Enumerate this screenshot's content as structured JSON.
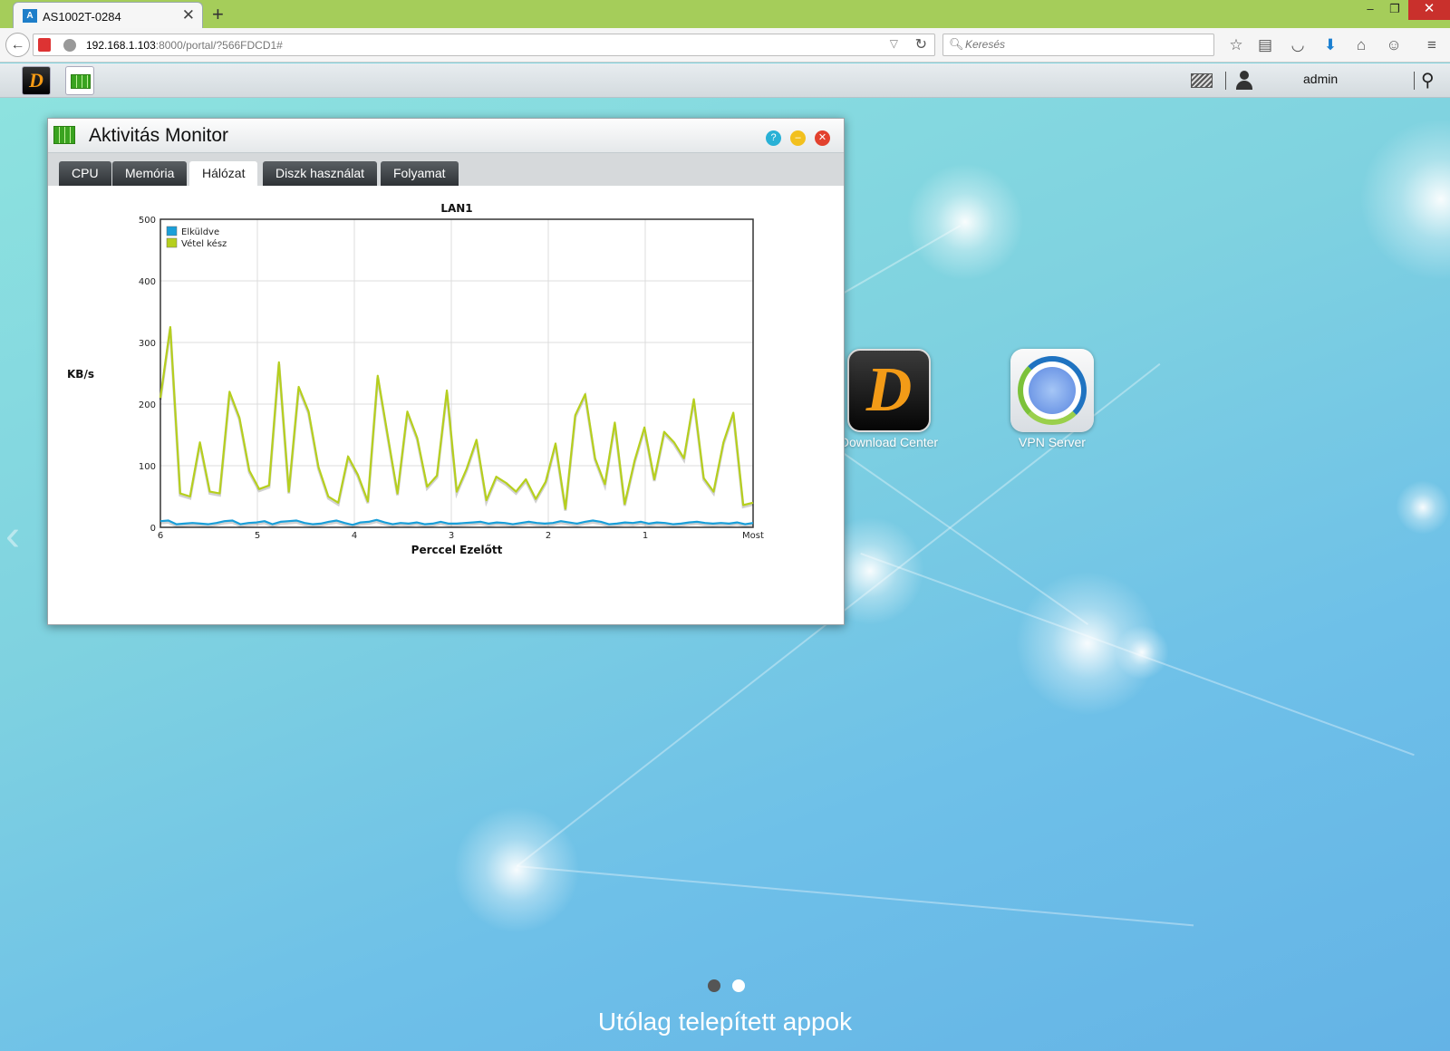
{
  "browser": {
    "tab_title": "AS1002T-0284",
    "tab_favicon": "A",
    "url_host": "192.168.1.103",
    "url_rest": ":8000/portal/?566FDCD1#",
    "search_placeholder": "Keresés"
  },
  "topbar": {
    "user": "admin"
  },
  "window": {
    "title": "Aktivitás Monitor",
    "tabs": [
      {
        "label": "CPU"
      },
      {
        "label": "Memória"
      },
      {
        "label": "Hálózat"
      },
      {
        "label": "Diszk használat"
      },
      {
        "label": "Folyamat"
      }
    ],
    "active_tab": "Hálózat"
  },
  "chart_data": {
    "type": "line",
    "title": "LAN1",
    "xlabel": "Perccel Ezelőtt",
    "ylabel": "KB/s",
    "ylim": [
      0,
      500
    ],
    "yticks": [
      0,
      100,
      200,
      300,
      400,
      500
    ],
    "xticks": [
      "6",
      "5",
      "4",
      "3",
      "2",
      "1",
      "Most"
    ],
    "grid": true,
    "legend_position": "top-left",
    "series": [
      {
        "name": "Elküldve",
        "color": "#1a9fd9",
        "values": [
          10,
          11,
          5,
          6,
          7,
          6,
          5,
          7,
          10,
          11,
          5,
          7,
          8,
          10,
          5,
          9,
          10,
          11,
          7,
          5,
          6,
          9,
          11,
          7,
          4,
          8,
          9,
          12,
          8,
          5,
          7,
          6,
          8,
          5,
          6,
          9,
          6,
          6,
          7,
          8,
          9,
          6,
          8,
          7,
          5,
          7,
          9,
          7,
          6,
          7,
          10,
          8,
          6,
          9,
          11,
          9,
          5,
          6,
          8,
          7,
          9,
          6,
          8,
          7,
          5,
          6,
          8,
          9,
          7,
          6,
          7,
          6,
          8,
          5,
          7
        ]
      },
      {
        "name": "Vétel kész",
        "color": "#b6cf1e",
        "values": [
          210,
          325,
          55,
          50,
          138,
          58,
          55,
          220,
          178,
          92,
          62,
          68,
          268,
          58,
          228,
          188,
          98,
          50,
          40,
          115,
          85,
          42,
          246,
          150,
          55,
          188,
          145,
          66,
          84,
          222,
          58,
          95,
          142,
          44,
          82,
          72,
          58,
          78,
          46,
          74,
          136,
          30,
          182,
          216,
          112,
          70,
          170,
          38,
          108,
          162,
          78,
          155,
          138,
          112,
          208,
          80,
          58,
          138,
          186,
          36,
          40
        ]
      }
    ]
  },
  "desktop": {
    "apps": [
      {
        "label": "Download Center",
        "icon": "download-center-icon"
      },
      {
        "label": "VPN Server",
        "icon": "vpn-server-icon"
      }
    ],
    "page_title": "Utólag telepített appok",
    "pages": 2,
    "current_page": 1
  }
}
